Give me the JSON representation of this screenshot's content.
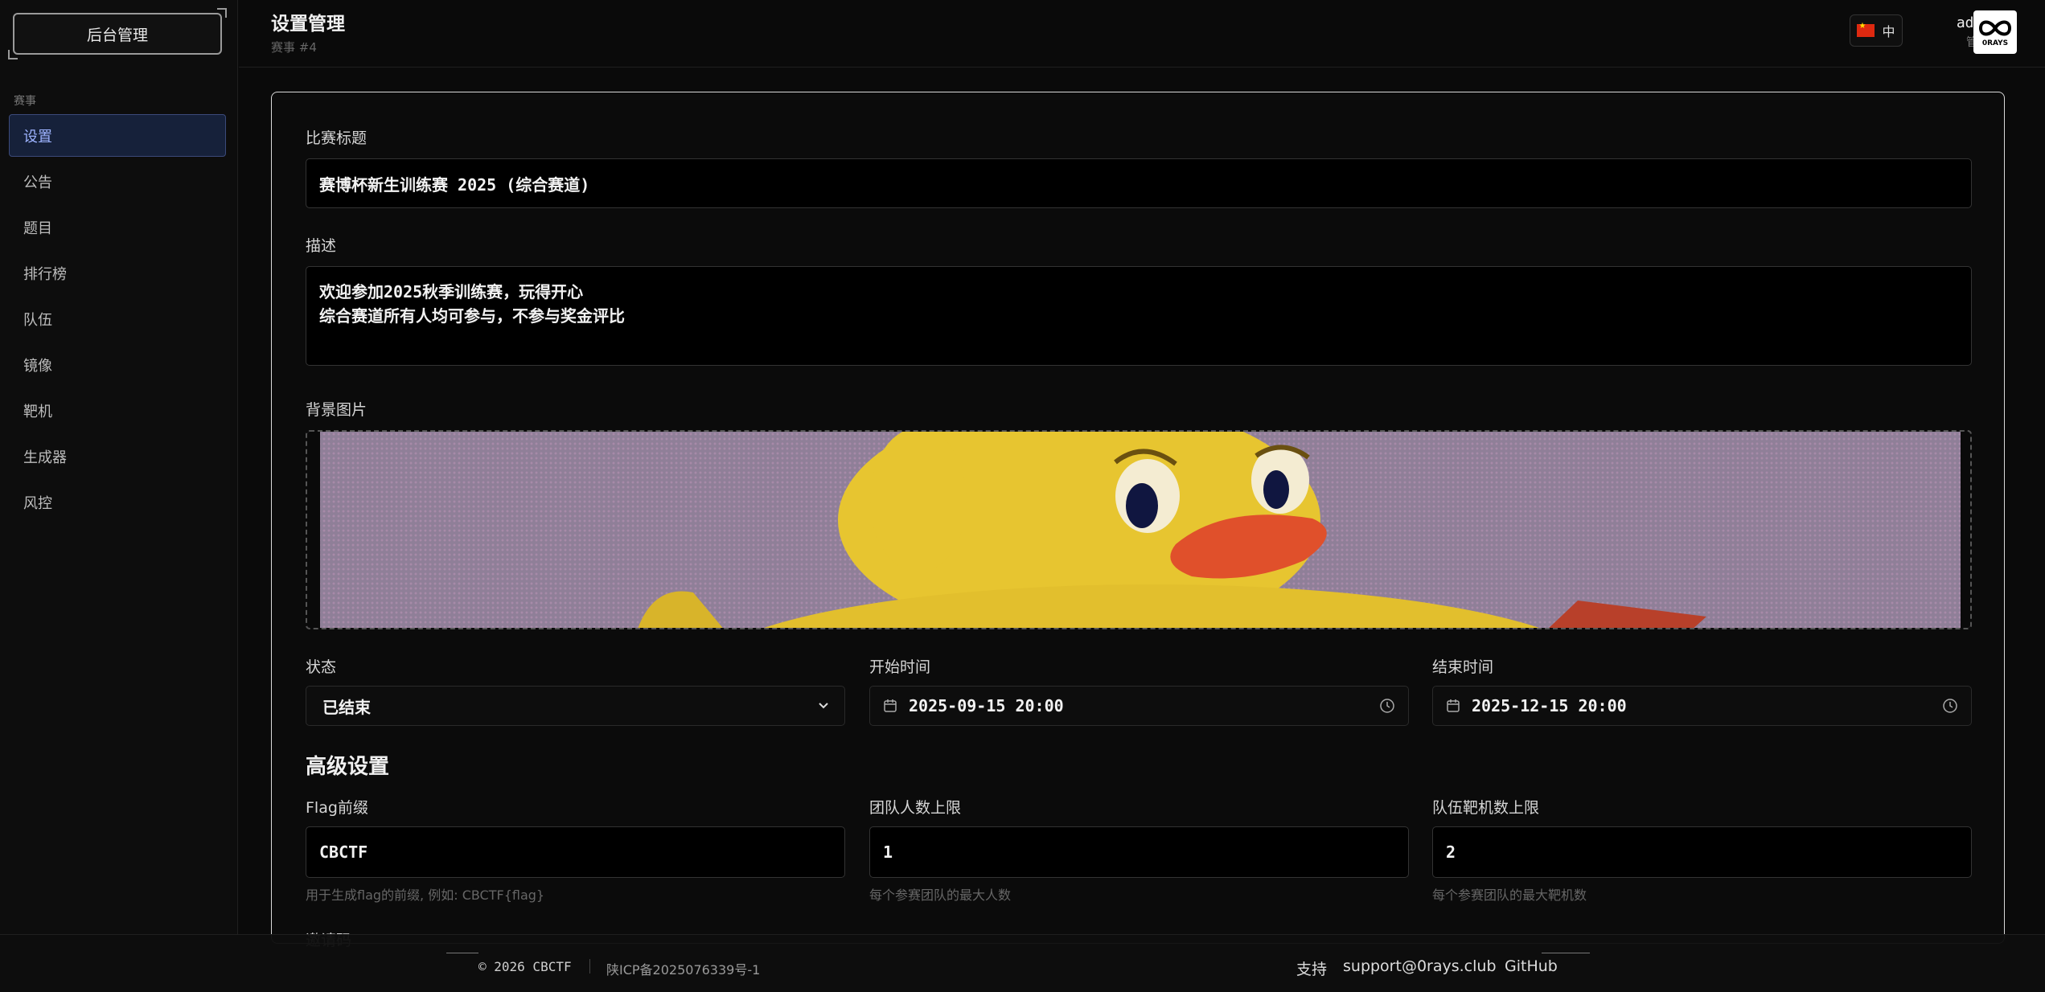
{
  "sidebar": {
    "brand": "后台管理",
    "section_label": "赛事",
    "items": [
      {
        "label": "设置",
        "active": true
      },
      {
        "label": "公告"
      },
      {
        "label": "题目"
      },
      {
        "label": "排行榜"
      },
      {
        "label": "队伍"
      },
      {
        "label": "镜像"
      },
      {
        "label": "靶机"
      },
      {
        "label": "生成器"
      },
      {
        "label": "风控"
      }
    ]
  },
  "header": {
    "title": "设置管理",
    "subtitle": "赛事 #4",
    "language": "中",
    "user": {
      "name": "admin",
      "role": "管理员"
    },
    "avatar_text": "0RAYS"
  },
  "form": {
    "title_label": "比赛标题",
    "title_value": "赛博杯新生训练赛 2025 (综合赛道)",
    "desc_label": "描述",
    "desc_line1": "欢迎参加2025秋季训练赛，玩得开心",
    "desc_line2": "综合赛道所有人均可参与，不参与奖金评比",
    "bg_label": "背景图片",
    "status_label": "状态",
    "status_value": "已结束",
    "start_label": "开始时间",
    "start_value": "2025-09-15 20:00",
    "end_label": "结束时间",
    "end_value": "2025-12-15 20:00"
  },
  "advanced": {
    "title": "高级设置",
    "flag_prefix_label": "Flag前缀",
    "flag_prefix_value": "CBCTF",
    "flag_prefix_hint": "用于生成flag的前缀, 例如: CBCTF{flag}",
    "team_size_label": "团队人数上限",
    "team_size_value": "1",
    "team_size_hint": "每个参赛团队的最大人数",
    "team_vm_label": "队伍靶机数上限",
    "team_vm_value": "2",
    "team_vm_hint": "每个参赛团队的最大靶机数",
    "invite_label": "邀请码"
  },
  "footer": {
    "copyright": "© 2026 CBCTF",
    "icp": "陕ICP备2025076339号-1",
    "support_label": "支持",
    "support_email": "support@0rays.club",
    "github": "GitHub"
  },
  "colors": {
    "accent": "#9db3ff",
    "active_bg": "#16213a",
    "background": "#0a0a0a"
  }
}
